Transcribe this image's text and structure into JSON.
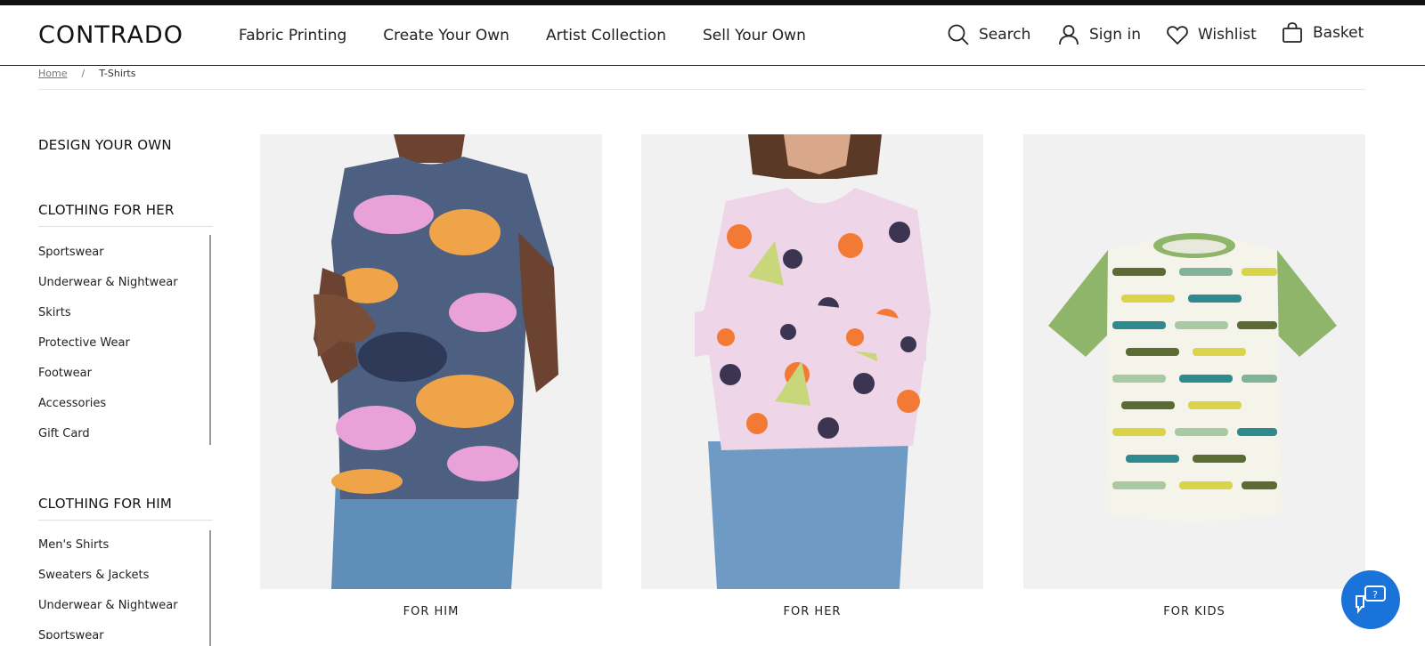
{
  "header": {
    "logo": "CONTRADO",
    "nav": [
      "Fabric Printing",
      "Create Your Own",
      "Artist Collection",
      "Sell Your Own"
    ],
    "search_label": "Search",
    "signin_label": "Sign in",
    "wishlist_label": "Wishlist",
    "basket_label": "Basket"
  },
  "breadcrumb": {
    "home": "Home",
    "separator": "/",
    "current": "T-Shirts"
  },
  "sidebar": {
    "design_heading": "DESIGN YOUR OWN",
    "her_heading": "CLOTHING FOR HER",
    "her_items": [
      "Sportswear",
      "Underwear & Nightwear",
      "Skirts",
      "Protective Wear",
      "Footwear",
      "Accessories",
      "Gift Card"
    ],
    "him_heading": "CLOTHING FOR HIM",
    "him_items": [
      "Men's Shirts",
      "Sweaters & Jackets",
      "Underwear & Nightwear",
      "Sportswear"
    ]
  },
  "products": [
    {
      "label": "FOR HIM"
    },
    {
      "label": "FOR HER"
    },
    {
      "label": "FOR KIDS"
    }
  ],
  "colors": {
    "accent": "#1a73d9",
    "card_bg": "#f1f1f1",
    "text": "#1a1a1a"
  },
  "icons": {
    "search": "search-icon",
    "signin": "user-icon",
    "wishlist": "heart-icon",
    "basket": "bag-icon",
    "chat": "chat-help-icon"
  }
}
